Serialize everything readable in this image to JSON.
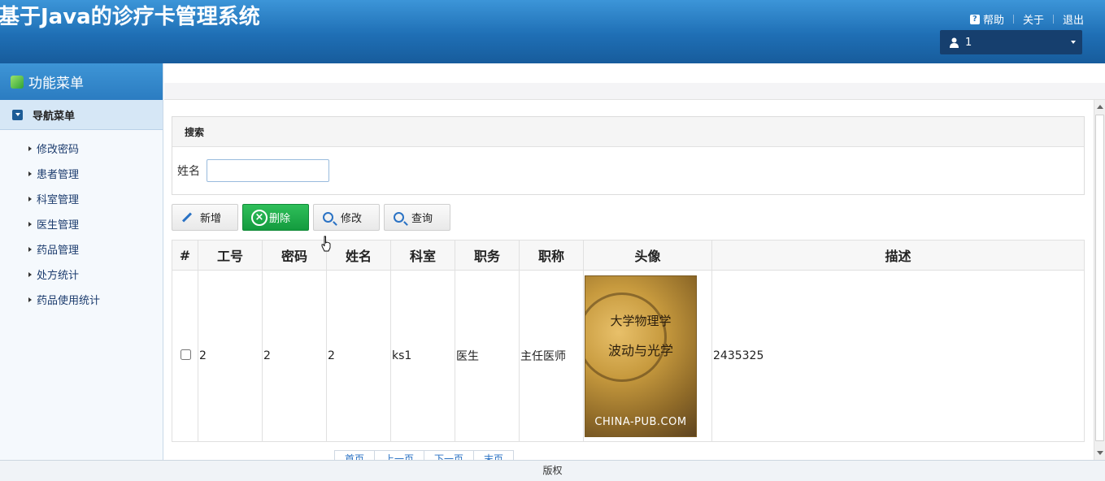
{
  "header": {
    "title": "基于Java的诊疗卡管理系统",
    "links": {
      "help": "帮助",
      "about": "关于",
      "logout": "退出"
    },
    "user": "1"
  },
  "sidebar": {
    "title": "功能菜单",
    "group": "导航菜单",
    "items": [
      "修改密码",
      "患者管理",
      "科室管理",
      "医生管理",
      "药品管理",
      "处方统计",
      "药品使用统计"
    ]
  },
  "search": {
    "panel_title": "搜索",
    "name_label": "姓名",
    "name_value": ""
  },
  "toolbar": {
    "add": "新增",
    "delete": "删除",
    "edit": "修改",
    "query": "查询"
  },
  "table": {
    "headers": [
      "#",
      "工号",
      "密码",
      "姓名",
      "科室",
      "职务",
      "职称",
      "头像",
      "描述"
    ],
    "rows": [
      {
        "id": "2",
        "password": "2",
        "name": "2",
        "dept": "ks1",
        "position": "医生",
        "title": "主任医师",
        "avatar_text_main": "大学物理学",
        "avatar_text_sub": "波动与光学",
        "avatar_watermark": "CHINA-PUB.COM",
        "desc": "2435325"
      }
    ]
  },
  "pager": [
    "首页",
    "上一页",
    "下一页",
    "末页"
  ],
  "footer": "版权"
}
